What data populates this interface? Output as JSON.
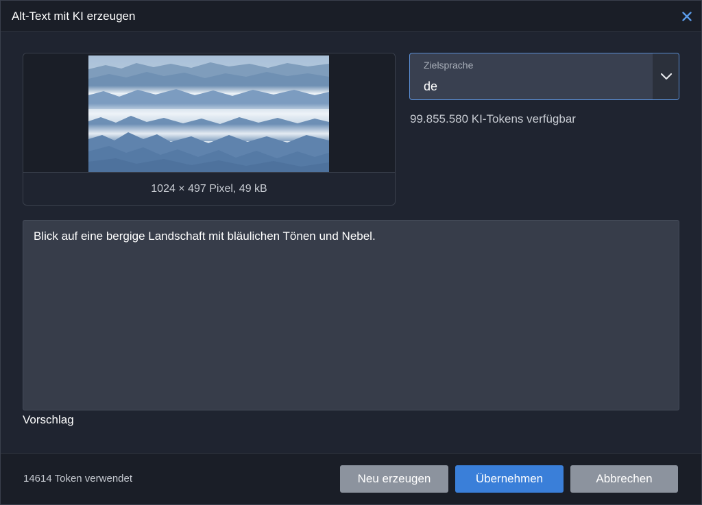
{
  "dialog": {
    "title": "Alt-Text mit KI erzeugen",
    "accent_color": "#3a7fd9"
  },
  "image": {
    "meta": "1024 × 497 Pixel, 49 kB"
  },
  "language_select": {
    "label": "Zielsprache",
    "value": "de"
  },
  "tokens": {
    "available": "99.855.580 KI-Tokens verfügbar",
    "used": "14614 Token verwendet"
  },
  "suggestion": {
    "text": "Blick auf eine bergige Landschaft mit bläulichen Tönen und Nebel.",
    "label": "Vorschlag"
  },
  "buttons": {
    "regenerate": "Neu erzeugen",
    "apply": "Übernehmen",
    "cancel": "Abbrechen"
  },
  "icons": {
    "close": "close-icon",
    "dropdown": "chevron-down-icon"
  }
}
